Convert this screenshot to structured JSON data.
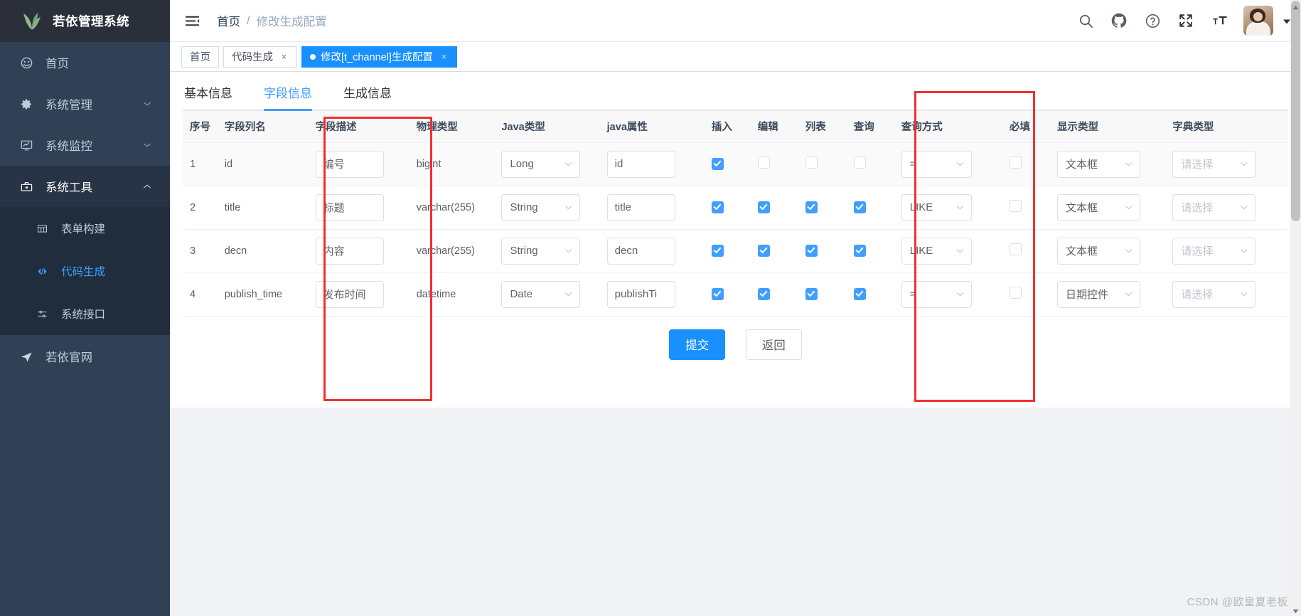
{
  "app": {
    "title": "若依管理系统"
  },
  "sidebar": {
    "items": [
      {
        "label": "首页",
        "icon": "dashboard-icon",
        "arrow": ""
      },
      {
        "label": "系统管理",
        "icon": "gear-icon",
        "arrow": "down"
      },
      {
        "label": "系统监控",
        "icon": "monitor-icon",
        "arrow": "down"
      },
      {
        "label": "系统工具",
        "icon": "toolbox-icon",
        "arrow": "up"
      }
    ],
    "submenu": [
      {
        "label": "表单构建",
        "icon": "table-icon",
        "active": "false"
      },
      {
        "label": "代码生成",
        "icon": "code-icon",
        "active": "true"
      },
      {
        "label": "系统接口",
        "icon": "sliders-icon",
        "active": "false"
      }
    ],
    "site": {
      "label": "若依官网",
      "icon": "send-icon"
    }
  },
  "navbar": {
    "hamburger": "hamburger-icon",
    "breadcrumb": {
      "home": "首页",
      "sep": "/",
      "current": "修改生成配置"
    },
    "icons": [
      "search-icon",
      "github-icon",
      "question-icon",
      "fullscreen-icon",
      "font-size-icon"
    ]
  },
  "tabs": [
    {
      "label": "首页",
      "closable": "false",
      "active": "false",
      "close": "×"
    },
    {
      "label": "代码生成",
      "closable": "true",
      "active": "false",
      "close": "×"
    },
    {
      "label": "修改[t_channel]生成配置",
      "closable": "true",
      "active": "true",
      "close": "×"
    }
  ],
  "form_tabs": [
    {
      "label": "基本信息",
      "active": "false"
    },
    {
      "label": "字段信息",
      "active": "true"
    },
    {
      "label": "生成信息",
      "active": "false"
    }
  ],
  "table": {
    "headers": [
      "序号",
      "字段列名",
      "字段描述",
      "物理类型",
      "Java类型",
      "java属性",
      "插入",
      "编辑",
      "列表",
      "查询",
      "查询方式",
      "必填",
      "显示类型",
      "字典类型"
    ],
    "dict_placeholder": "请选择",
    "rows": [
      {
        "index": "1",
        "column": "id",
        "desc": "编号",
        "physical": "bigint",
        "java_type": "Long",
        "java_attr": "id",
        "insert": "true",
        "edit": "false",
        "list": "false",
        "query": "false",
        "query_type": "=",
        "required": "false",
        "show_type": "文本框",
        "dict_type": "请选择"
      },
      {
        "index": "2",
        "column": "title",
        "desc": "标题",
        "physical": "varchar(255)",
        "java_type": "String",
        "java_attr": "title",
        "insert": "true",
        "edit": "true",
        "list": "true",
        "query": "true",
        "query_type": "LIKE",
        "required": "false",
        "show_type": "文本框",
        "dict_type": "请选择"
      },
      {
        "index": "3",
        "column": "decn",
        "desc": "内容",
        "physical": "varchar(255)",
        "java_type": "String",
        "java_attr": "decn",
        "insert": "true",
        "edit": "true",
        "list": "true",
        "query": "true",
        "query_type": "LIKE",
        "required": "false",
        "show_type": "文本框",
        "dict_type": "请选择"
      },
      {
        "index": "4",
        "column": "publish_time",
        "desc": "发布时间",
        "physical": "datetime",
        "java_type": "Date",
        "java_attr": "publishTi",
        "insert": "true",
        "edit": "true",
        "list": "true",
        "query": "true",
        "query_type": "=",
        "required": "false",
        "show_type": "日期控件",
        "dict_type": "请选择"
      }
    ]
  },
  "actions": {
    "submit": "提交",
    "back": "返回"
  },
  "watermark": "CSDN @欧皇夏老板",
  "colors": {
    "sidebar_bg": "#304156",
    "sidebar_sub_bg": "#1f2d3d",
    "accent": "#409eff",
    "tab_active": "#1890ff",
    "annotation": "#f03030"
  }
}
